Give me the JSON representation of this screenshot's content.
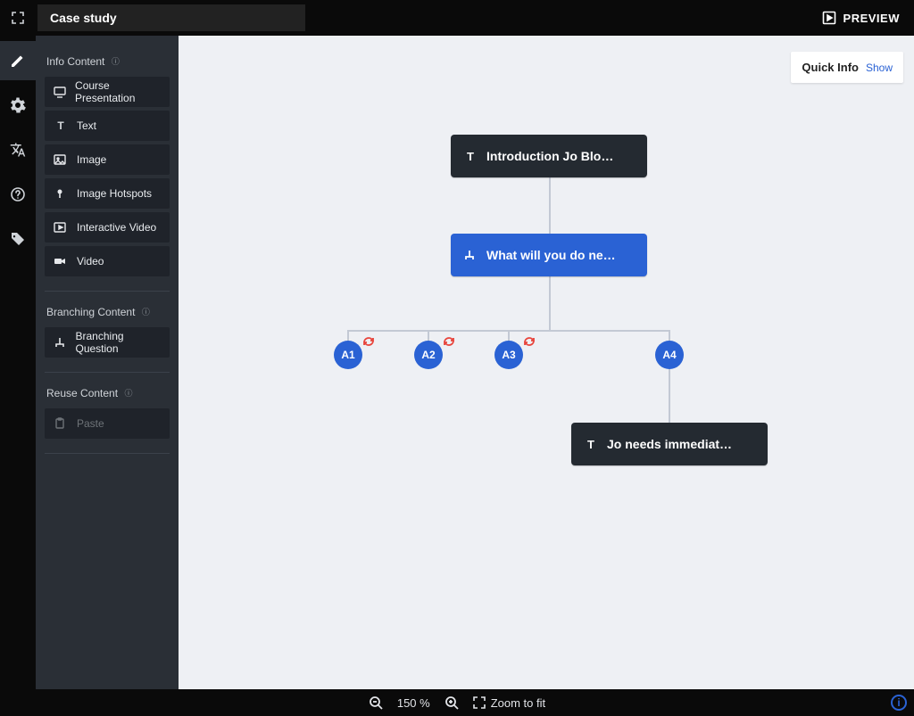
{
  "header": {
    "title": "Case study",
    "preview_label": "PREVIEW"
  },
  "rail": {
    "items": [
      {
        "name": "pencil",
        "active": true
      },
      {
        "name": "gear",
        "active": false
      },
      {
        "name": "translate",
        "active": false
      },
      {
        "name": "help",
        "active": false
      },
      {
        "name": "tag",
        "active": false
      }
    ]
  },
  "side": {
    "sections": {
      "info": {
        "title": "Info Content"
      },
      "branching": {
        "title": "Branching Content"
      },
      "reuse": {
        "title": "Reuse Content"
      }
    },
    "info_items": [
      {
        "icon": "presentation",
        "label": "Course Presentation"
      },
      {
        "icon": "text",
        "label": "Text"
      },
      {
        "icon": "image",
        "label": "Image"
      },
      {
        "icon": "hotspots",
        "label": "Image Hotspots"
      },
      {
        "icon": "ivideo",
        "label": "Interactive Video"
      },
      {
        "icon": "video",
        "label": "Video"
      }
    ],
    "branching_items": [
      {
        "icon": "branchq",
        "label": "Branching Question"
      }
    ],
    "reuse_items": [
      {
        "icon": "paste",
        "label": "Paste",
        "disabled": true
      }
    ]
  },
  "quick_info": {
    "title": "Quick Info",
    "show": "Show"
  },
  "tree": {
    "root": {
      "label": "Introduction Jo Blo…"
    },
    "question": {
      "label": "What will you do ne…"
    },
    "alts": [
      "A1",
      "A2",
      "A3",
      "A4"
    ],
    "leaf": {
      "label": "Jo needs immediat…"
    }
  },
  "status": {
    "zoom_level": "150 %",
    "zoom_fit": "Zoom to fit"
  },
  "colors": {
    "accent_blue": "#2a62d4",
    "panel_dark": "#2a2f36",
    "canvas_bg": "#eef0f4",
    "node_dark": "#242a31",
    "warn_red": "#e8453c"
  }
}
